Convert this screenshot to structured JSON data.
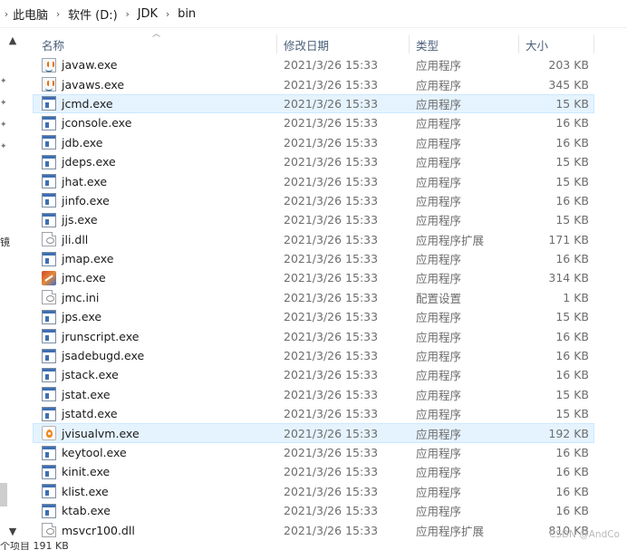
{
  "breadcrumb": {
    "items": [
      "此电脑",
      "软件 (D:)",
      "JDK",
      "bin"
    ]
  },
  "columns": {
    "name": "名称",
    "date": "修改日期",
    "type": "类型",
    "size": "大小"
  },
  "files": [
    {
      "name": "javaw.exe",
      "date": "2021/3/26 15:33",
      "type": "应用程序",
      "size": "203 KB",
      "icon": "java-icon"
    },
    {
      "name": "javaws.exe",
      "date": "2021/3/26 15:33",
      "type": "应用程序",
      "size": "345 KB",
      "icon": "java-icon"
    },
    {
      "name": "jcmd.exe",
      "date": "2021/3/26 15:33",
      "type": "应用程序",
      "size": "15 KB",
      "icon": "exe-icon"
    },
    {
      "name": "jconsole.exe",
      "date": "2021/3/26 15:33",
      "type": "应用程序",
      "size": "16 KB",
      "icon": "exe-icon"
    },
    {
      "name": "jdb.exe",
      "date": "2021/3/26 15:33",
      "type": "应用程序",
      "size": "16 KB",
      "icon": "exe-icon"
    },
    {
      "name": "jdeps.exe",
      "date": "2021/3/26 15:33",
      "type": "应用程序",
      "size": "15 KB",
      "icon": "exe-icon"
    },
    {
      "name": "jhat.exe",
      "date": "2021/3/26 15:33",
      "type": "应用程序",
      "size": "15 KB",
      "icon": "exe-icon"
    },
    {
      "name": "jinfo.exe",
      "date": "2021/3/26 15:33",
      "type": "应用程序",
      "size": "16 KB",
      "icon": "exe-icon"
    },
    {
      "name": "jjs.exe",
      "date": "2021/3/26 15:33",
      "type": "应用程序",
      "size": "15 KB",
      "icon": "exe-icon"
    },
    {
      "name": "jli.dll",
      "date": "2021/3/26 15:33",
      "type": "应用程序扩展",
      "size": "171 KB",
      "icon": "dll-icon"
    },
    {
      "name": "jmap.exe",
      "date": "2021/3/26 15:33",
      "type": "应用程序",
      "size": "16 KB",
      "icon": "exe-icon"
    },
    {
      "name": "jmc.exe",
      "date": "2021/3/26 15:33",
      "type": "应用程序",
      "size": "314 KB",
      "icon": "jmc-icon"
    },
    {
      "name": "jmc.ini",
      "date": "2021/3/26 15:33",
      "type": "配置设置",
      "size": "1 KB",
      "icon": "ini-icon"
    },
    {
      "name": "jps.exe",
      "date": "2021/3/26 15:33",
      "type": "应用程序",
      "size": "15 KB",
      "icon": "exe-icon"
    },
    {
      "name": "jrunscript.exe",
      "date": "2021/3/26 15:33",
      "type": "应用程序",
      "size": "16 KB",
      "icon": "exe-icon"
    },
    {
      "name": "jsadebugd.exe",
      "date": "2021/3/26 15:33",
      "type": "应用程序",
      "size": "16 KB",
      "icon": "exe-icon"
    },
    {
      "name": "jstack.exe",
      "date": "2021/3/26 15:33",
      "type": "应用程序",
      "size": "16 KB",
      "icon": "exe-icon"
    },
    {
      "name": "jstat.exe",
      "date": "2021/3/26 15:33",
      "type": "应用程序",
      "size": "15 KB",
      "icon": "exe-icon"
    },
    {
      "name": "jstatd.exe",
      "date": "2021/3/26 15:33",
      "type": "应用程序",
      "size": "15 KB",
      "icon": "exe-icon"
    },
    {
      "name": "jvisualvm.exe",
      "date": "2021/3/26 15:33",
      "type": "应用程序",
      "size": "192 KB",
      "icon": "visualvm-icon"
    },
    {
      "name": "keytool.exe",
      "date": "2021/3/26 15:33",
      "type": "应用程序",
      "size": "16 KB",
      "icon": "exe-icon"
    },
    {
      "name": "kinit.exe",
      "date": "2021/3/26 15:33",
      "type": "应用程序",
      "size": "16 KB",
      "icon": "exe-icon"
    },
    {
      "name": "klist.exe",
      "date": "2021/3/26 15:33",
      "type": "应用程序",
      "size": "16 KB",
      "icon": "exe-icon"
    },
    {
      "name": "ktab.exe",
      "date": "2021/3/26 15:33",
      "type": "应用程序",
      "size": "16 KB",
      "icon": "exe-icon"
    },
    {
      "name": "msvcr100.dll",
      "date": "2021/3/26 15:33",
      "type": "应用程序扩展",
      "size": "810 KB",
      "icon": "dll-icon"
    }
  ],
  "highlighted": [
    "jcmd.exe",
    "jvisualvm.exe"
  ],
  "status": {
    "text": "个项目  191 KB"
  },
  "nav": {
    "cut_char": "镜"
  },
  "watermark": "CSDN @AndCo",
  "colors": {
    "selection": "#e5f3ff",
    "selection_border": "#cce8ff",
    "header_text": "#4c607a"
  }
}
